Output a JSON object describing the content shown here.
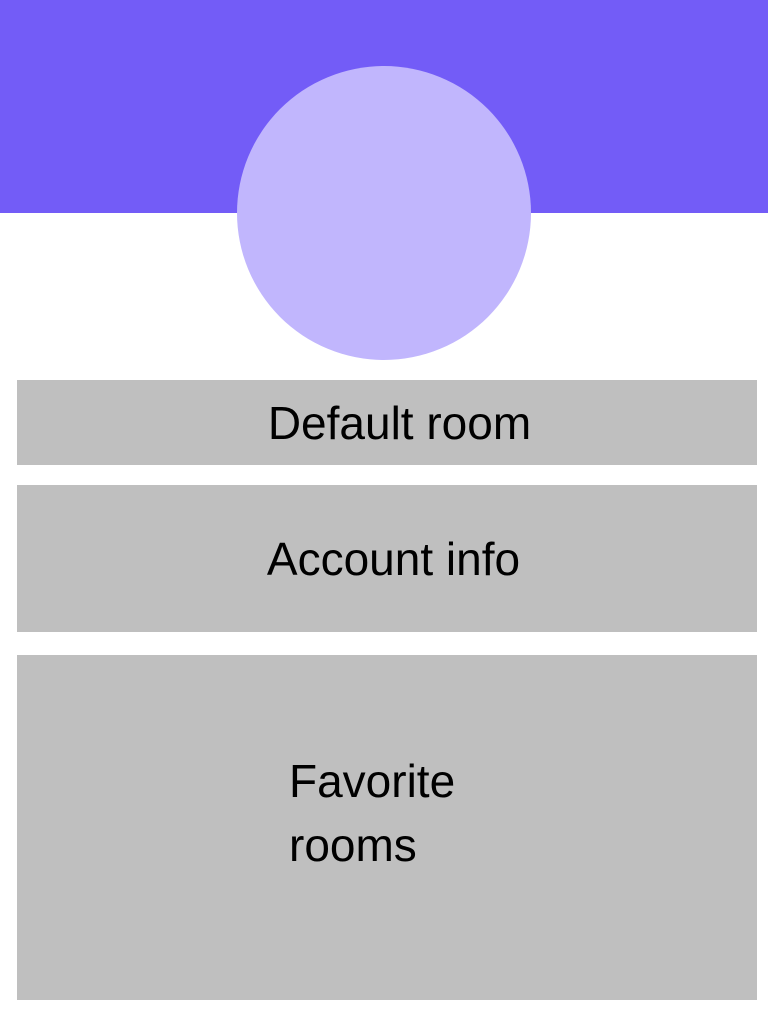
{
  "colors": {
    "header": "#735cf7",
    "avatar": "#c1b6fd",
    "panel": "#bfbfbf",
    "text": "#000000",
    "background": "#ffffff"
  },
  "profile": {
    "avatar_icon": "avatar-placeholder-circle"
  },
  "menu": {
    "default_room": "Default room",
    "account_info": "Account info",
    "favorite_rooms": "Favorite rooms"
  }
}
